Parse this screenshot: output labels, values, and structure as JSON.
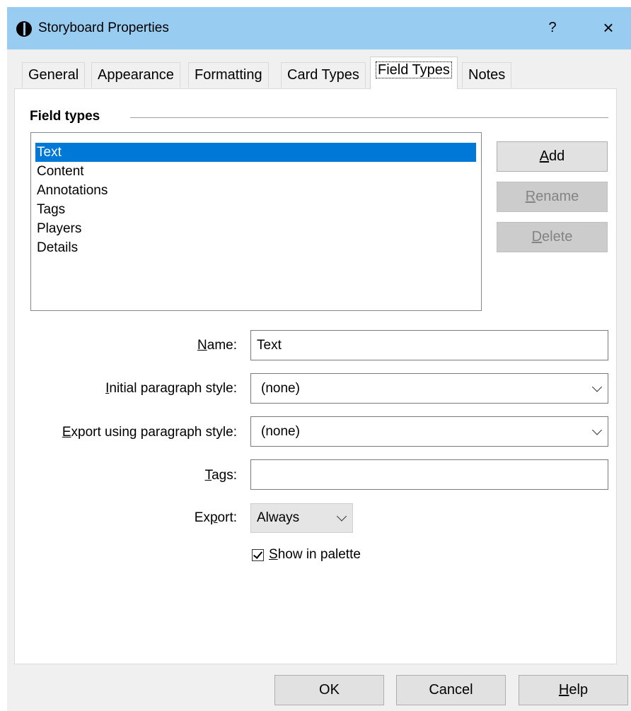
{
  "window": {
    "title": "Storyboard Properties",
    "help_label": "?",
    "close_label": "×"
  },
  "tabs": [
    {
      "label": "General"
    },
    {
      "label": "Appearance"
    },
    {
      "label": "Formatting"
    },
    {
      "label": "Card Types"
    },
    {
      "label": "Field Types",
      "active": true
    },
    {
      "label": "Notes"
    }
  ],
  "group_title": "Field types",
  "field_types": [
    "Text",
    "Content",
    "Annotations",
    "Tags",
    "Players",
    "Details"
  ],
  "selected_field_type": "Text",
  "buttons": {
    "add": {
      "hotkey": "A",
      "rest": "dd"
    },
    "rename": {
      "hotkey": "R",
      "rest": "ename"
    },
    "delete": {
      "hotkey": "D",
      "rest": "elete"
    }
  },
  "form": {
    "name_label_hot": "N",
    "name_label_rest": "ame:",
    "name_value": "Text",
    "initial_label_hot": "I",
    "initial_label_rest": "nitial paragraph style:",
    "initial_value": "(none)",
    "export_style_label_hot": "E",
    "export_style_label_rest": "xport using paragraph style:",
    "export_style_value": "(none)",
    "tags_label_hot": "T",
    "tags_label_rest": "ags:",
    "tags_value": "",
    "export_label_pre": "Ex",
    "export_label_hot": "p",
    "export_label_rest": "ort:",
    "export_value": "Always",
    "show_palette_hot": "S",
    "show_palette_rest": "how in palette",
    "show_palette_checked": true
  },
  "footer": {
    "ok_label": "OK",
    "cancel_label": "Cancel",
    "help_hot": "H",
    "help_rest": "elp"
  }
}
